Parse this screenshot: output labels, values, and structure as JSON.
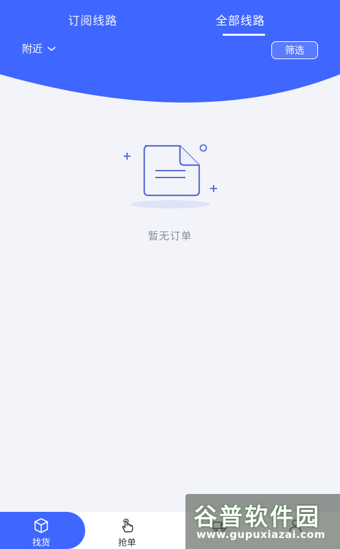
{
  "header": {
    "tabs": [
      {
        "label": "订阅线路",
        "active": false
      },
      {
        "label": "全部线路",
        "active": true
      }
    ],
    "location": "附近",
    "filter_label": "筛选"
  },
  "main": {
    "empty_text": "暂无订单"
  },
  "tabbar": {
    "items": [
      {
        "label": "找货",
        "icon": "box-icon",
        "active": true
      },
      {
        "label": "抢单",
        "icon": "hand-tap-icon",
        "active": false
      },
      {
        "label": "",
        "icon": "truck-icon",
        "active": false
      },
      {
        "label": "",
        "icon": "user-icon",
        "active": false
      }
    ]
  },
  "watermark": {
    "title": "谷普软件园",
    "url": "www.gupuxiazai.com"
  },
  "colors": {
    "primary": "#3f66ff",
    "background": "#f3f4f9",
    "illustration": "#5b6fd9",
    "muted_text": "#8a8d99"
  }
}
